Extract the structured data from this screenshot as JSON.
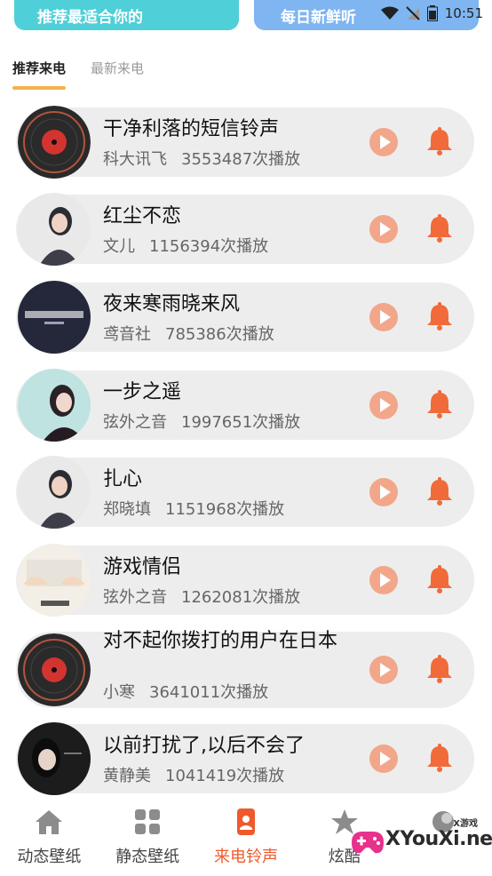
{
  "banners": {
    "left_label": "推荐最适合你的",
    "right_label": "每日新鲜听"
  },
  "status": {
    "time": "10:51"
  },
  "tabs": [
    {
      "label": "推荐来电",
      "active": true
    },
    {
      "label": "最新来电",
      "active": false
    }
  ],
  "ringtones": [
    {
      "title": "干净利落的短信铃声",
      "artist": "科大讯飞",
      "plays": "3553487次播放",
      "cover": "vinyl"
    },
    {
      "title": "红尘不恋",
      "artist": "文儿",
      "plays": "1156394次播放",
      "cover": "portrait-light"
    },
    {
      "title": "夜来寒雨晓来风",
      "artist": "鸢音社",
      "plays": "785386次播放",
      "cover": "dark-text"
    },
    {
      "title": "一步之遥",
      "artist": "弦外之音",
      "plays": "1997651次播放",
      "cover": "portrait-teal"
    },
    {
      "title": "扎心",
      "artist": "郑晓填",
      "plays": "1151968次播放",
      "cover": "portrait-light"
    },
    {
      "title": "游戏情侣",
      "artist": "弦外之音",
      "plays": "1262081次播放",
      "cover": "keyboard"
    },
    {
      "title": "对不起你拨打的用户在日本",
      "artist": "小寒",
      "plays": "3641011次播放",
      "cover": "vinyl"
    },
    {
      "title": "以前打扰了,以后不会了",
      "artist": "黄静美",
      "plays": "1041419次播放",
      "cover": "portrait-dark"
    }
  ],
  "bottom_nav": [
    {
      "label": "动态壁纸",
      "icon": "home-icon",
      "active": false
    },
    {
      "label": "静态壁纸",
      "icon": "grid-icon",
      "active": false
    },
    {
      "label": "来电铃声",
      "icon": "phone-icon",
      "active": true
    },
    {
      "label": "炫酷",
      "icon": "star-icon",
      "active": false
    },
    {
      "label": "",
      "icon": "theme-icon",
      "active": false
    }
  ],
  "watermark": {
    "top": "X游戏",
    "text": "XYouXi.net"
  },
  "colors": {
    "accent": "#ef5a2c",
    "play": "#f2a78a",
    "bell": "#f06a3a",
    "tab_indicator": "#f6b24a",
    "item_bg": "#ededed"
  }
}
